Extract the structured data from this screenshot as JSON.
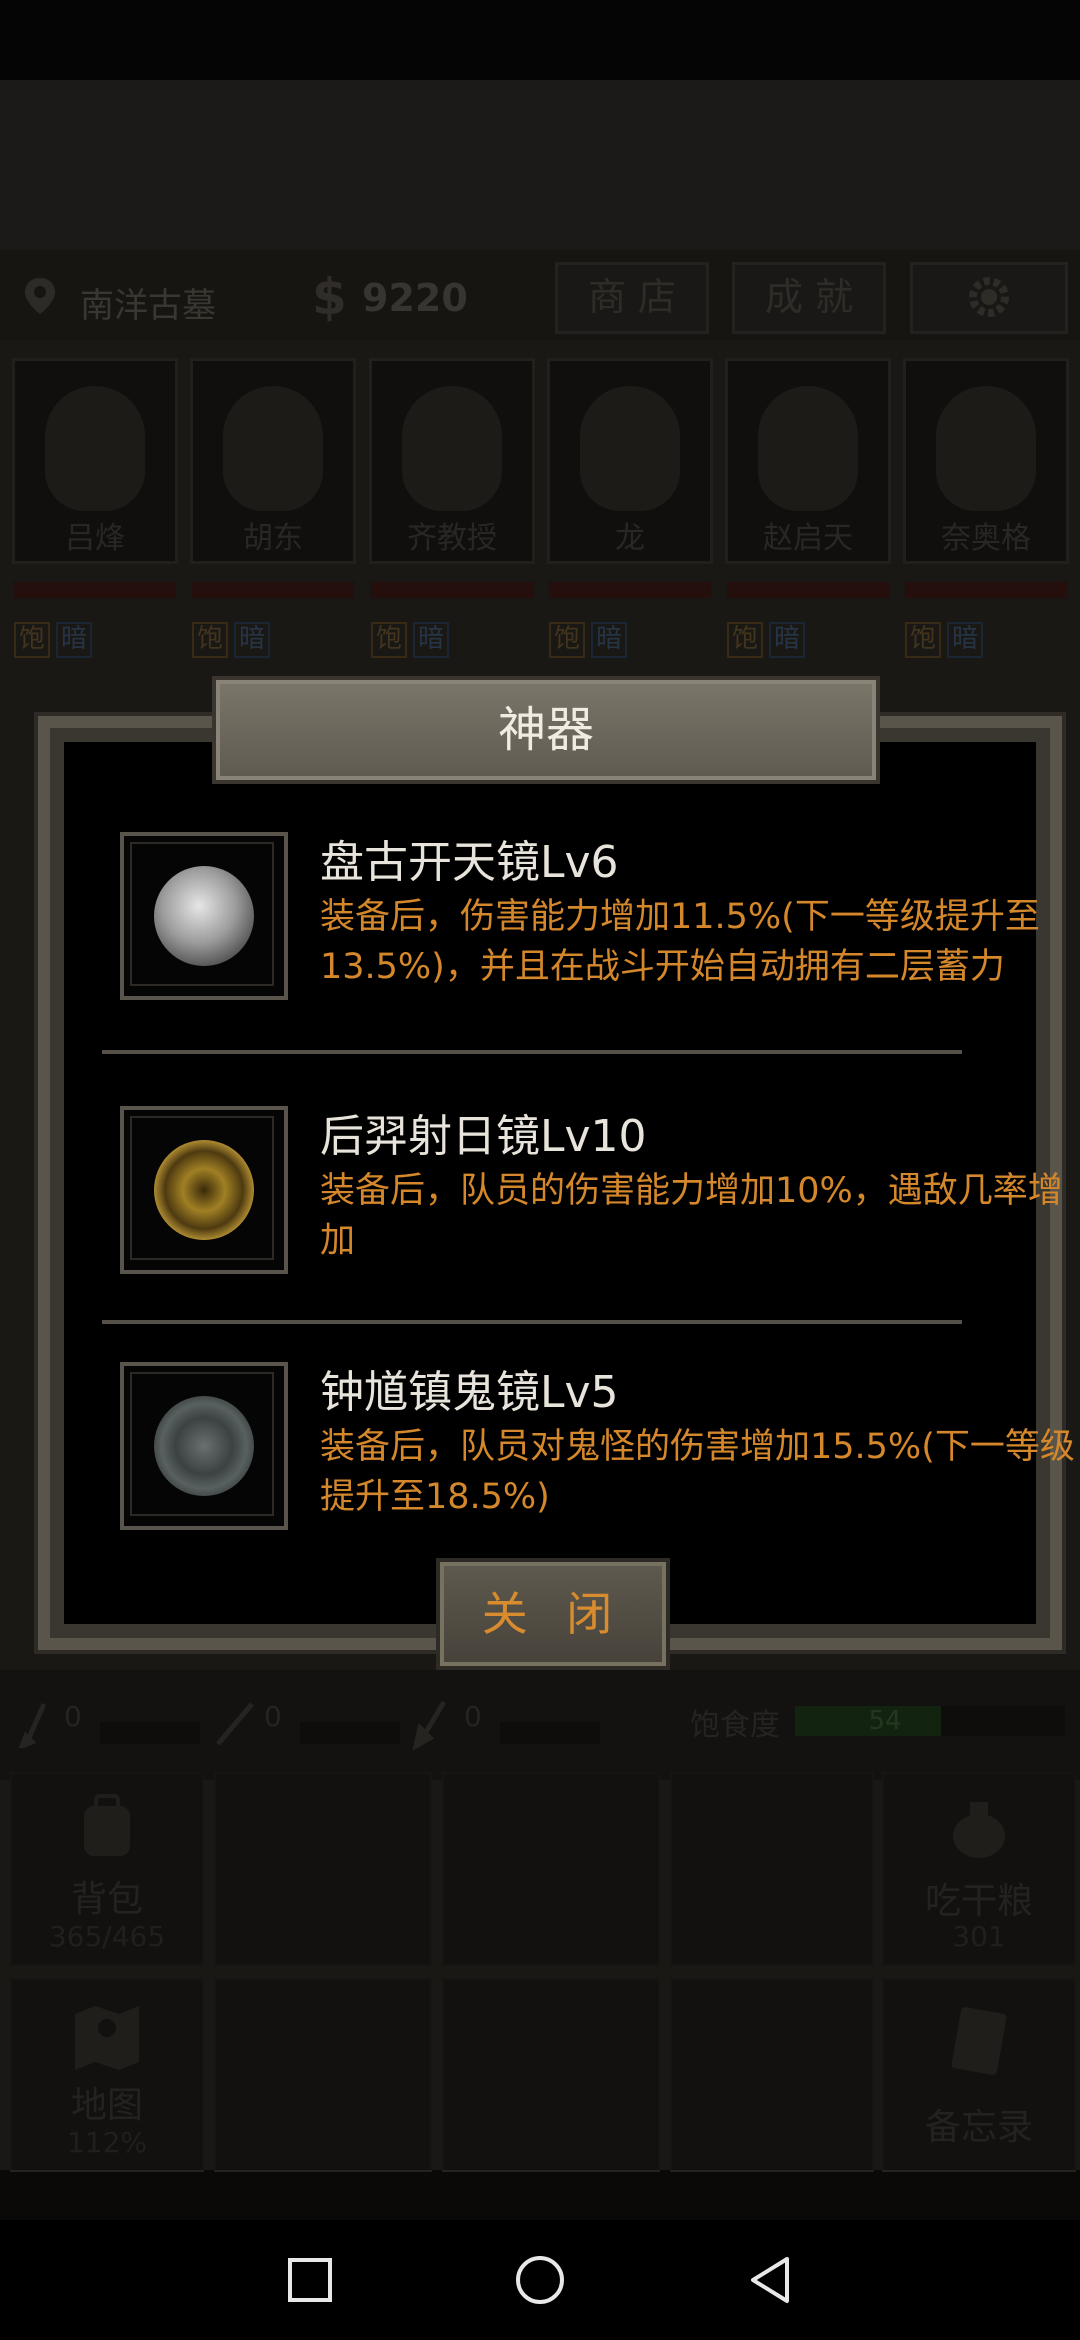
{
  "hud": {
    "location": "南洋古墓",
    "money_symbol": "$",
    "money": "9220",
    "shop_label": "商 店",
    "achievements_label": "成 就"
  },
  "party": [
    {
      "name": "吕烽"
    },
    {
      "name": "胡东"
    },
    {
      "name": "齐教授"
    },
    {
      "name": "龙"
    },
    {
      "name": "赵启天"
    },
    {
      "name": "奈奥格"
    }
  ],
  "status_tags": {
    "satiety": "饱",
    "dark": "暗"
  },
  "toolbar": {
    "tool1_count": "0",
    "tool2_count": "0",
    "tool3_count": "0",
    "satiety_label": "饱食度",
    "satiety_value": "54",
    "satiety_fraction": 0.54
  },
  "menu": {
    "bag_label": "背包",
    "bag_count": "365/465",
    "eat_label": "吃干粮",
    "eat_count": "301",
    "map_label": "地图",
    "map_progress": "112%",
    "memo_label": "备忘录"
  },
  "dialog": {
    "title": "神器",
    "close_label": "关 闭",
    "artifacts": [
      {
        "name": "盘古开天镜Lv6",
        "desc": "装备后，伤害能力增加11.5%(下一等级提升至13.5%)，并且在战斗开始自动拥有二层蓄力"
      },
      {
        "name": "后羿射日镜Lv10",
        "desc": "装备后，队员的伤害能力增加10%，遇敌几率增加"
      },
      {
        "name": "钟馗镇鬼镜Lv5",
        "desc": "装备后，队员对鬼怪的伤害增加15.5%(下一等级提升至18.5%)"
      }
    ]
  },
  "colors": {
    "accent_orange": "#d4882b",
    "title_text": "#f0ece4",
    "dialog_border": "#5a554b"
  }
}
